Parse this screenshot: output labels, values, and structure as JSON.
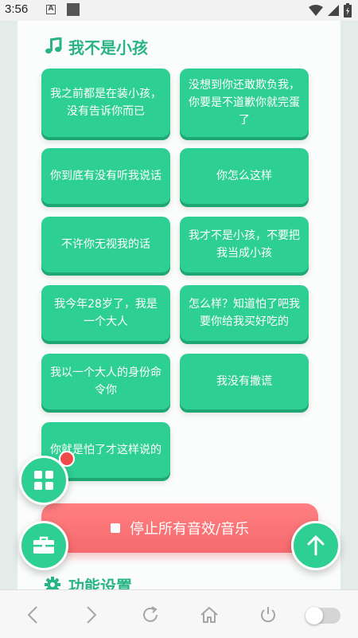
{
  "status_bar": {
    "time": "3:56",
    "notification_letter": "A"
  },
  "section": {
    "title": "我不是小孩",
    "icon": "music-note-icon"
  },
  "sound_buttons": [
    {
      "label": "我之前都是在装小孩，没有告诉你而已"
    },
    {
      "label": "没想到你还敢欺负我，你要是不道歉你就完蛋了"
    },
    {
      "label": "你到底有没有听我说话"
    },
    {
      "label": "你怎么这样"
    },
    {
      "label": "不许你无视我的话"
    },
    {
      "label": "我才不是小孩，不要把我当成小孩"
    },
    {
      "label": "我今年28岁了，我是一个大人"
    },
    {
      "label": "怎么样？知道怕了吧我要你给我买好吃的"
    },
    {
      "label": "我以一个大人的身份命令你"
    },
    {
      "label": "我没有撒谎"
    },
    {
      "label": "你就是怕了才这样说的"
    }
  ],
  "stop_button": {
    "label": "停止所有音效/音乐"
  },
  "settings_section": {
    "title": "功能设置",
    "icon": "gear-icon"
  },
  "fabs": {
    "menu_icon": "grid-icon",
    "toolbox_icon": "toolbox-icon",
    "scroll_top_icon": "arrow-up-icon"
  },
  "colors": {
    "accent": "#2ecf92",
    "accent_dark": "#1ea773",
    "title": "#29b487",
    "stop": "#f56a6d",
    "badge": "#f04a4a"
  },
  "bottom_nav": {
    "toggle_on": false
  }
}
